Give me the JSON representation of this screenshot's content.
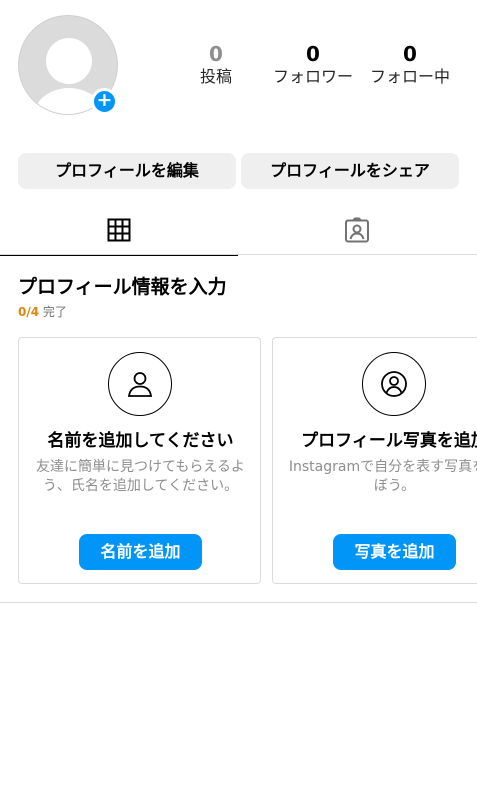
{
  "profile": {
    "avatar_icon": "default-avatar",
    "add_badge_symbol": "+"
  },
  "stats": [
    {
      "value": "0",
      "label": "投稿"
    },
    {
      "value": "0",
      "label": "フォロワー"
    },
    {
      "value": "0",
      "label": "フォロー中"
    }
  ],
  "actions": {
    "edit_profile": "プロフィールを編集",
    "share_profile": "プロフィールをシェア"
  },
  "tabs": [
    {
      "icon": "grid-icon",
      "active": true
    },
    {
      "icon": "tagged-icon",
      "active": false
    }
  ],
  "onboarding": {
    "title": "プロフィール情報を入力",
    "progress_count": "0/4",
    "progress_label": "完了",
    "cards": [
      {
        "icon": "person-icon",
        "title": "名前を追加してください",
        "description": "友達に簡単に見つけてもらえるよう、氏名を追加してください。",
        "button": "名前を追加"
      },
      {
        "icon": "profile-photo-icon",
        "title": "プロフィール写真を追加",
        "description": "Instagramで自分を表す写真を選ぼう。",
        "button": "写真を追加"
      }
    ]
  },
  "colors": {
    "accent_blue": "#0095f6",
    "progress_orange": "#e1860d",
    "button_gray": "#efefef",
    "divider": "#dbdbdb"
  }
}
